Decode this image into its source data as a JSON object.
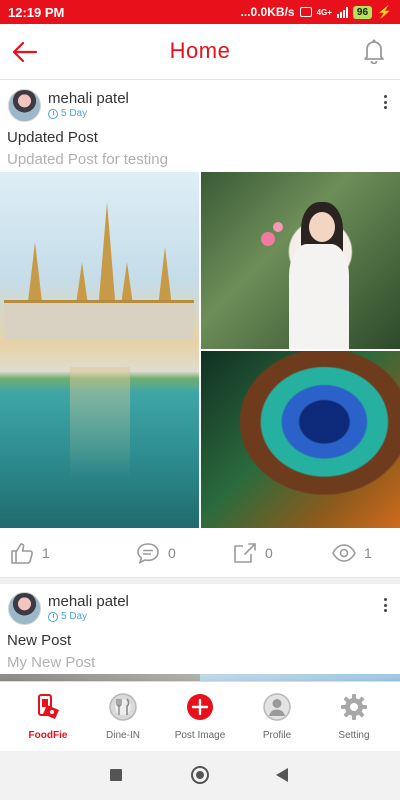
{
  "status_bar": {
    "time": "12:19 PM",
    "network_speed": "...0.0KB/s",
    "network_type": "4G+",
    "battery": "96",
    "background_color": "#e8101a"
  },
  "app_bar": {
    "title": "Home",
    "back_icon": "arrow-left-icon",
    "notification_icon": "bell-icon",
    "accent_color": "#e8101a"
  },
  "posts": [
    {
      "author": "mehali patel",
      "time_ago": "5 Day",
      "title": "Updated Post",
      "description": "Updated Post for testing",
      "images": [
        "temple-photo",
        "woman-with-flowers-photo",
        "peacock-feather-photo"
      ],
      "likes": "1",
      "comments": "0",
      "shares": "0",
      "views": "1"
    },
    {
      "author": "mehali patel",
      "time_ago": "5 Day",
      "title": "New Post",
      "description": "My New Post"
    }
  ],
  "bottom_nav": {
    "items": [
      {
        "label": "FoodFie",
        "icon": "foodfie-icon",
        "active": true
      },
      {
        "label": "Dine-IN",
        "icon": "fork-knife-icon",
        "active": false
      },
      {
        "label": "Post Image",
        "icon": "plus-circle-icon",
        "active": false
      },
      {
        "label": "Profile",
        "icon": "user-icon",
        "active": false
      },
      {
        "label": "Setting",
        "icon": "gear-icon",
        "active": false
      }
    ]
  }
}
